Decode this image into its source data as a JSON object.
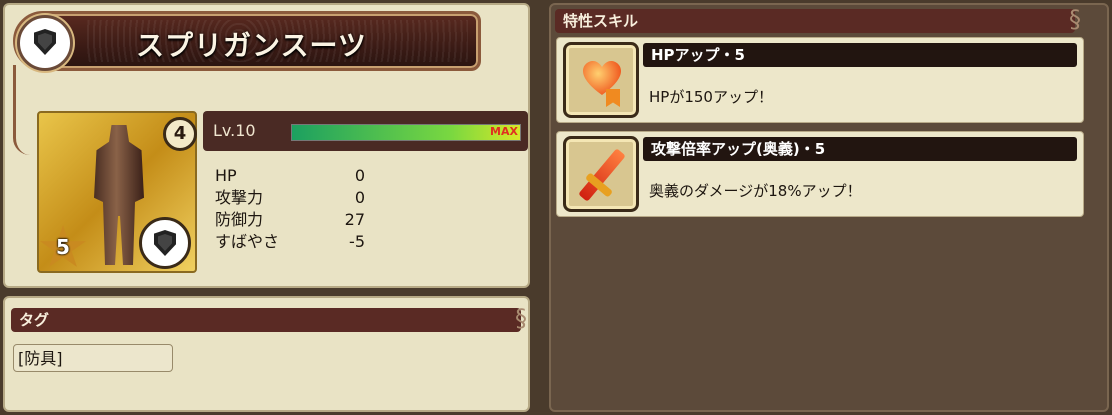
{
  "equipment": {
    "name": "スプリガンスーツ",
    "level_badge": "4",
    "rarity": "5",
    "level_label": "Lv.10",
    "exp_fraction": 1.0,
    "exp_max_label": "MAX"
  },
  "stats": [
    {
      "name": "HP",
      "value": "0"
    },
    {
      "name": "攻撃力",
      "value": "0"
    },
    {
      "name": "防御力",
      "value": "27"
    },
    {
      "name": "すばやさ",
      "value": "-5"
    }
  ],
  "tag_section": {
    "header": "タグ",
    "value": "[防具]"
  },
  "skills_section": {
    "header": "特性スキル",
    "skills": [
      {
        "name": "HPアップ・5",
        "description": "HPが150アップ！",
        "icon": "heart-icon"
      },
      {
        "name": "攻撃倍率アップ(奥義)・5",
        "description": "奥義のダメージが18%アップ！",
        "icon": "sword-icon"
      }
    ]
  },
  "colors": {
    "panel_bg": "#e9e3c5",
    "header_bg": "#5a2a24",
    "page_bg": "#4a3b2c"
  }
}
